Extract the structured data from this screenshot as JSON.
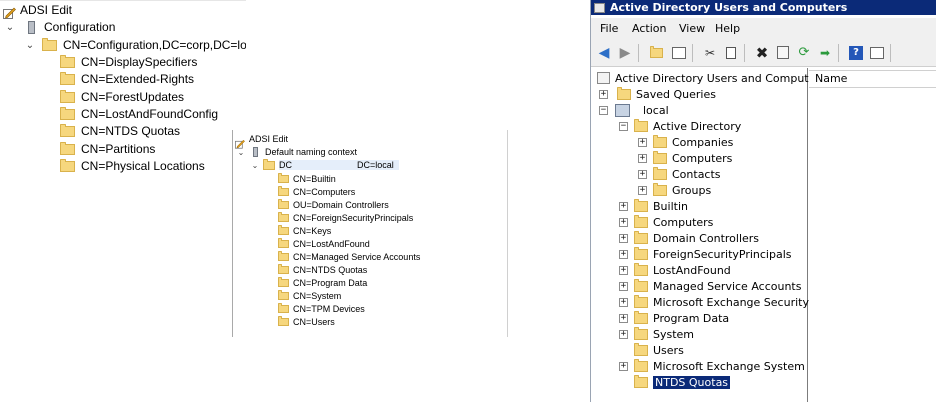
{
  "panel1": {
    "title": "ADSI Edit",
    "root": "Configuration",
    "node": "CN=Configuration,DC=corp,DC=loc",
    "children": [
      "CN=DisplaySpecifiers",
      "CN=Extended-Rights",
      "CN=ForestUpdates",
      "CN=LostAndFoundConfig",
      "CN=NTDS Quotas",
      "CN=Partitions",
      "CN=Physical Locations"
    ]
  },
  "panel2": {
    "title": "ADSI Edit",
    "root": "Default naming context",
    "node_left": "DC",
    "node_right": "DC=local",
    "children": [
      "CN=Builtin",
      "CN=Computers",
      "OU=Domain Controllers",
      "CN=ForeignSecurityPrincipals",
      "CN=Keys",
      "CN=LostAndFound",
      "CN=Managed Service Accounts",
      "CN=NTDS Quotas",
      "CN=Program Data",
      "CN=System",
      "CN=TPM Devices",
      "CN=Users"
    ]
  },
  "panel3": {
    "title": "Active Directory Users and Computers",
    "menu": [
      "File",
      "Action",
      "View",
      "Help"
    ],
    "tree_root": "Active Directory Users and Computers",
    "saved_queries": "Saved Queries",
    "domain": "local",
    "ad_folder": "Active Directory",
    "ad_children": [
      "Companies",
      "Computers",
      "Contacts",
      "Groups"
    ],
    "items": [
      "Builtin",
      "Computers",
      "Domain Controllers",
      "ForeignSecurityPrincipals",
      "LostAndFound",
      "Managed Service Accounts",
      "Microsoft Exchange Security Gr",
      "Program Data",
      "System",
      "Users",
      "Microsoft Exchange System Ob",
      "NTDS Quotas"
    ],
    "list_header": "Name",
    "selected_color": "#0b2a78"
  }
}
